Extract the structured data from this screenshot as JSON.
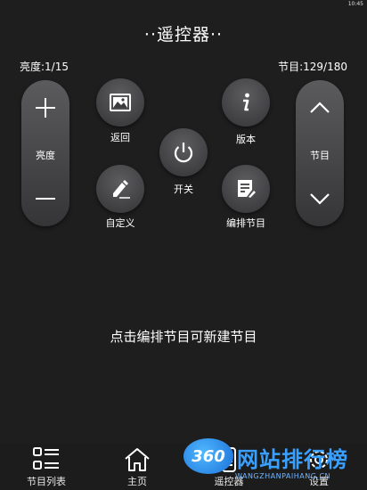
{
  "status": {
    "time": "10:45"
  },
  "title": "··遥控器··",
  "brightness_info": "亮度:1/15",
  "channel_info": "节目:129/180",
  "brightness_pill": {
    "plus_icon": "plus-icon",
    "label": "亮度",
    "minus_icon": "minus-icon"
  },
  "channel_pill": {
    "up_icon": "chevron-up-icon",
    "label": "节目",
    "down_icon": "chevron-down-icon"
  },
  "buttons": {
    "back": {
      "label": "返回",
      "icon": "image-icon"
    },
    "version": {
      "label": "版本",
      "icon": "info-icon"
    },
    "power": {
      "label": "开关",
      "icon": "power-icon"
    },
    "custom": {
      "label": "自定义",
      "icon": "pencil-icon"
    },
    "edit_programs": {
      "label": "编排节目",
      "icon": "edit-document-icon"
    }
  },
  "hint": "点击编排节目可新建节目",
  "tabs": [
    {
      "label": "节目列表",
      "icon": "list-icon"
    },
    {
      "label": "主页",
      "icon": "home-icon"
    },
    {
      "label": "遥控器",
      "icon": "remote-icon"
    },
    {
      "label": "设置",
      "icon": "settings-icon"
    }
  ],
  "watermark": {
    "logo": "360",
    "text": "网站排行榜",
    "sub": "WANGZHANPAIHANG.CN"
  },
  "colors": {
    "background": "#1e1e1f",
    "button": "#4a4a4c",
    "text": "#ffffff",
    "watermark": "#3aa0ff"
  }
}
